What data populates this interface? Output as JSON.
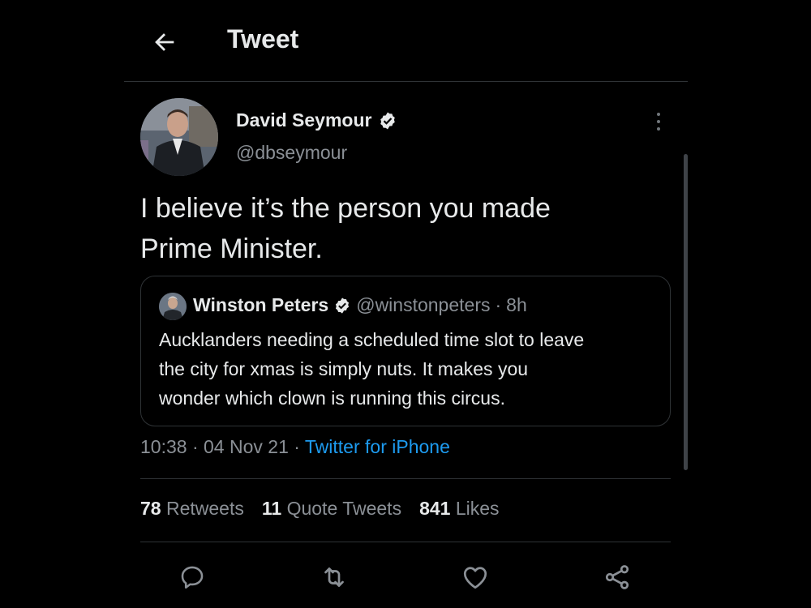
{
  "header": {
    "title": "Tweet"
  },
  "tweet": {
    "author_name": "David Seymour",
    "author_handle": "@dbseymour",
    "verified": true,
    "text_line1": "I believe it’s the person you made",
    "text_line2": "Prime Minister.",
    "time": "10:38",
    "date": "04 Nov 21",
    "source": "Twitter for iPhone"
  },
  "quote": {
    "author_name": "Winston Peters",
    "author_handle": "@winstonpeters",
    "separator": "·",
    "age": "8h",
    "verified": true,
    "text_line1": "Aucklanders needing a scheduled time slot to leave",
    "text_line2": "the city for xmas is simply nuts.  It makes you",
    "text_line3": "wonder which clown is running this circus."
  },
  "stats": {
    "retweets_count": "78",
    "retweets_label": "Retweets",
    "quotes_count": "11",
    "quotes_label": "Quote Tweets",
    "likes_count": "841",
    "likes_label": "Likes"
  },
  "icons": {
    "back": "arrow-left-icon",
    "more": "more-vertical-icon",
    "verified": "verified-badge-icon",
    "reply": "reply-icon",
    "retweet": "retweet-icon",
    "like": "heart-icon",
    "share": "share-icon"
  },
  "colors": {
    "background": "#000000",
    "text_primary": "#e7e9ea",
    "text_secondary": "#8b9096",
    "accent": "#1d9bf0",
    "border": "#2f3336"
  }
}
